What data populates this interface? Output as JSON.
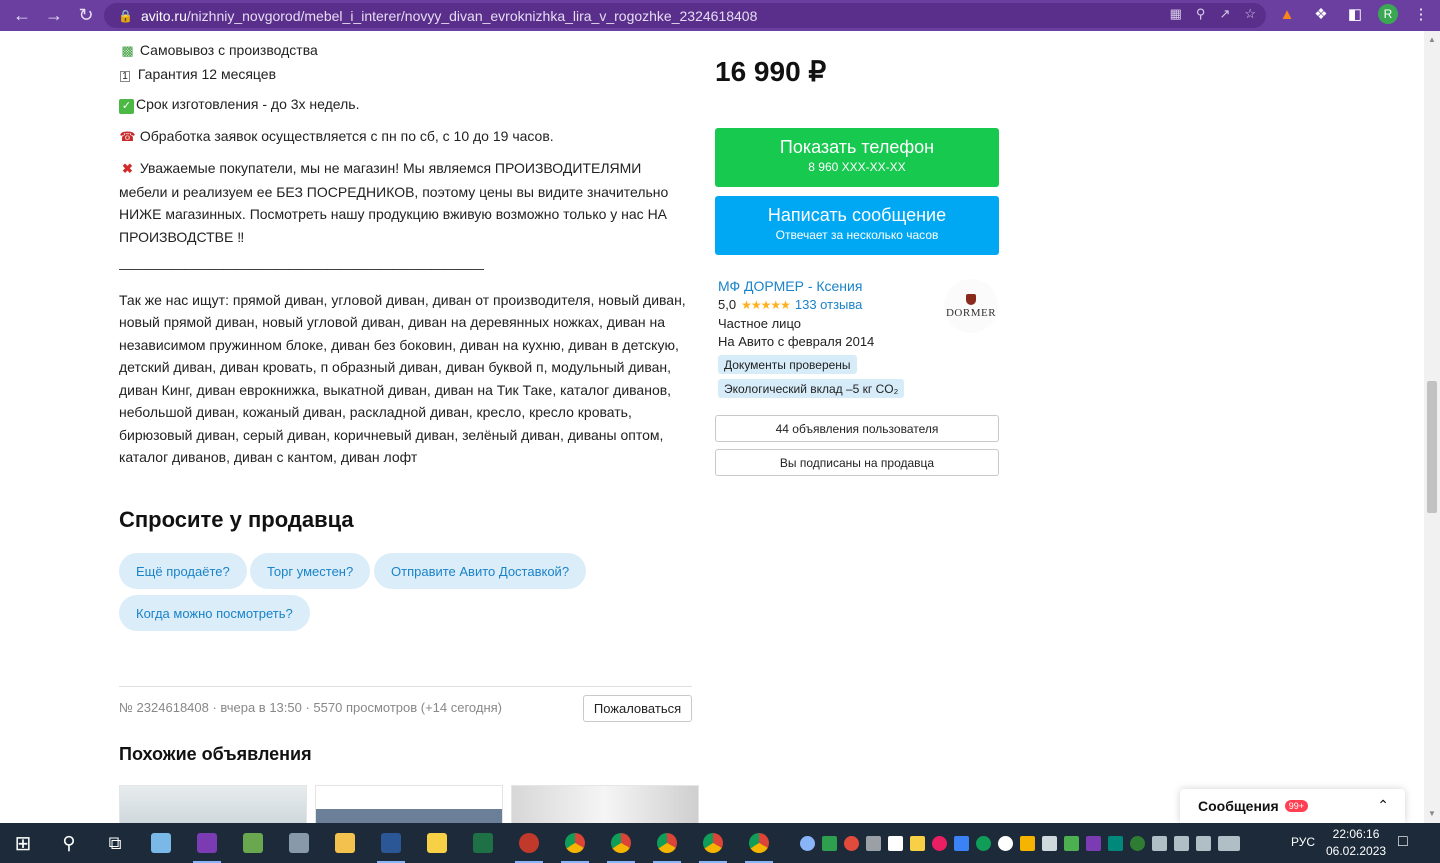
{
  "browser": {
    "url_host": "avito.ru",
    "url_path": "/nizhniy_novgorod/mebel_i_interer/novyy_divan_evroknizhka_lira_v_rogozhke_2324618408",
    "avatar_letter": "R"
  },
  "description": {
    "line_pickup": "Самовывоз с производства",
    "line_warranty": "Гарантия 12 месяцев",
    "line_term": "Срок изготовления - до 3х недель.",
    "line_hours": "Обработка заявок осуществляется с пн по сб, с 10 до 19 часов.",
    "line_notice": "Уважаемые покупатели, мы не магазин! Мы являемся ПРОИЗВОДИТЕЛЯМИ мебели и реализуем ее БЕЗ ПОСРЕДНИКОВ, поэтому цены вы видите значительно НИЖЕ магазинных. Посмотреть нашу продукцию вживую возможно только у нас НА ПРОИЗВОДСТВЕ ‼",
    "separator": "————————————————————————————",
    "keywords": "Так же нас ищут: прямой диван, угловой диван, диван от производителя, новый диван, новый прямой диван, новый угловой диван, диван на деревянных ножках, диван на независимом пружинном блоке, диван без боковин, диван на кухню, диван в детскую, детский диван, диван кровать, п образный диван, диван буквой п, модульный диван, диван Кинг, диван еврокнижка, выкатной диван, диван на Тик Таке, каталог диванов, небольшой диван, кожаный диван, раскладной диван, кресло, кресло кровать, бирюзовый диван, серый диван, коричневый диван, зелёный диван, диваны оптом, каталог диванов, диван с кантом, диван лофт"
  },
  "ask_seller": {
    "title": "Спросите у продавца",
    "chips": [
      "Ещё продаёте?",
      "Торг уместен?",
      "Отправите Авито Доставкой?",
      "Когда можно посмотреть?"
    ]
  },
  "listing_meta": {
    "text": "№ 2324618408 · вчера в 13:50 · 5570 просмотров (+14 сегодня)",
    "report_label": "Пожаловаться"
  },
  "similar": {
    "title": "Похожие объявления"
  },
  "sidebar": {
    "price": "16 990 ₽",
    "phone_button": {
      "label": "Показать телефон",
      "sub": "8 960 XXX-XX-XX"
    },
    "message_button": {
      "label": "Написать сообщение",
      "sub": "Отвечает за несколько часов"
    },
    "seller": {
      "name": "МФ ДОРМЕР - Ксения",
      "rating": "5,0",
      "stars": "★★★★★",
      "reviews": "133 отзыва",
      "type": "Частное лицо",
      "since": "На Авито с февраля 2014",
      "badge_docs": "Документы проверены",
      "badge_eco": "Экологический вклад –5 кг CO₂",
      "logo_text": "DORMER"
    },
    "listings_button": "44 объявления пользователя",
    "subscribed_button": "Вы подписаны на продавца"
  },
  "messages_panel": {
    "title": "Сообщения",
    "count": "99+"
  },
  "taskbar": {
    "lang": "РУС",
    "time": "22:06:16",
    "date": "06.02.2023"
  },
  "colors": {
    "green": "#17c94f",
    "blue": "#00a8f4",
    "link": "#1b83c8",
    "chrome": "#6b3fa0"
  }
}
